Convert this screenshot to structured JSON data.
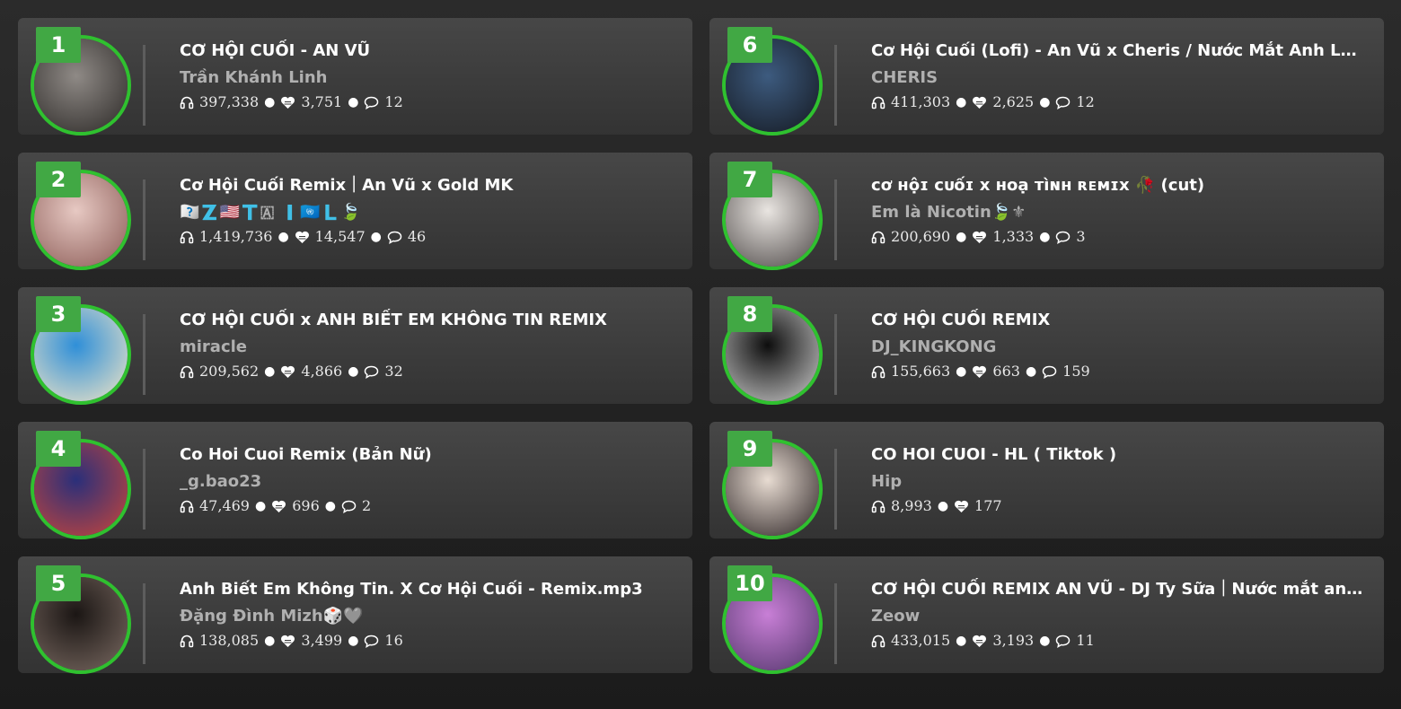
{
  "tracks": [
    {
      "rank": "1",
      "title": "CƠ HỘI CUỐI - AN VŨ",
      "artist": "Trần Khánh Linh",
      "plays": "397,338",
      "likes": "3,751",
      "comments": "12",
      "avatar_colors": [
        "#8f8a86",
        "#2b2826"
      ]
    },
    {
      "rank": "2",
      "title": "Cơ Hội Cuối Remix｜An Vũ x Gold MK",
      "artist": "🇯🇬🇿🇺🇸🇹🇦 🇮🇺🇳🇱🍃",
      "plays": "1,419,736",
      "likes": "14,547",
      "comments": "46",
      "avatar_colors": [
        "#e7c9c3",
        "#8a5a55"
      ]
    },
    {
      "rank": "3",
      "title": "CƠ HỘI CUỐI x ANH BIẾT EM KHÔNG TIN REMIX",
      "artist": "miracle",
      "plays": "209,562",
      "likes": "4,866",
      "comments": "32",
      "avatar_colors": [
        "#2f8fd8",
        "#f3e6c6"
      ]
    },
    {
      "rank": "4",
      "title": "Co Hoi Cuoi Remix (Bản Nữ)",
      "artist": "_g.bao23",
      "plays": "47,469",
      "likes": "696",
      "comments": "2",
      "avatar_colors": [
        "#2a2f7a",
        "#c9463a"
      ]
    },
    {
      "rank": "5",
      "title": "Anh Biết Em Không Tin. X  Cơ Hội Cuối - Remix.mp3",
      "artist": "Đặng Đình Mizh🎲🩶",
      "plays": "138,085",
      "likes": "3,499",
      "comments": "16",
      "avatar_colors": [
        "#1b1614",
        "#7a6a62"
      ]
    },
    {
      "rank": "6",
      "title": "Cơ Hội Cuối (Lofi) - An Vũ x Cheris / Nước Mắt Anh Lại Rơi Đến Cuối Cùng",
      "artist": "CHERIS",
      "plays": "411,303",
      "likes": "2,625",
      "comments": "12",
      "avatar_colors": [
        "#3d5b7f",
        "#141820"
      ]
    },
    {
      "rank": "7",
      "title": "ᴄơ ʜộɪ ᴄᴜốɪ x ʜᴏạ ᴛìɴʜ ʀᴇᴍɪx 🥀 (cut)",
      "artist": "Em là Nicotin🍃⚜",
      "plays": "200,690",
      "likes": "1,333",
      "comments": "3",
      "avatar_colors": [
        "#e9e5e1",
        "#4b4645"
      ]
    },
    {
      "rank": "8",
      "title": "CƠ HỘI CUỐI REMIX",
      "artist": "DJ_KINGKONG",
      "plays": "155,663",
      "likes": "663",
      "comments": "159",
      "avatar_colors": [
        "#0d0d0d",
        "#cfcfcf"
      ]
    },
    {
      "rank": "9",
      "title": "CO HOI CUOI - HL ( Tiktok )",
      "artist": "Hip",
      "plays": "8,993",
      "likes": "177",
      "comments": "",
      "avatar_colors": [
        "#e8dcd2",
        "#2a2223"
      ]
    },
    {
      "rank": "10",
      "title": "CƠ HỘI CUỐI REMIX AN VŨ - DJ Ty Sữa｜Nước mắt anh lại rơi đến cuối cùng",
      "artist": "Zeow",
      "plays": "433,015",
      "likes": "3,193",
      "comments": "11",
      "avatar_colors": [
        "#c87fd6",
        "#51356a"
      ]
    }
  ],
  "colors": {
    "accent": "#41a844",
    "ring": "#2fc12f",
    "card": "#3e3e3e",
    "muted": "#b0b0b0"
  },
  "icons": {
    "plays": "headphones-icon",
    "likes": "heart-icon",
    "comments": "comment-icon"
  }
}
